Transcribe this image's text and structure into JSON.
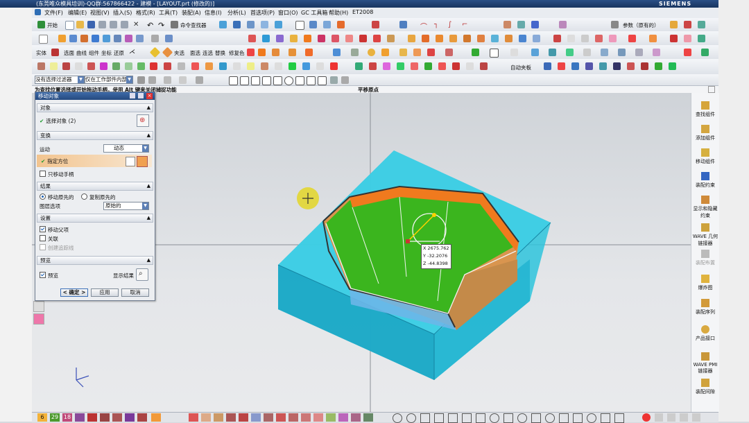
{
  "window": {
    "title": "(东莞唯众模具培训)-QQ群:567866422 - 建模 - [LAYOUT.prt (修改的)]",
    "brand": "SIEMENS"
  },
  "menubar": [
    "文件(F)",
    "编辑(E)",
    "视图(V)",
    "插入(S)",
    "格式(R)",
    "工具(T)",
    "装配(A)",
    "信息(I)",
    "分析(L)",
    "首选项(P)",
    "窗口(O)",
    "GC 工具箱",
    "帮助(H)",
    "ET2008"
  ],
  "toolbar1": {
    "start_label": "开始",
    "command_finder_label": "命令查找器",
    "reference_set_label": "参数（原有的）"
  },
  "toolbar3_labels": [
    "实体",
    "选面",
    "曲线",
    "组件",
    "坐标",
    "还原",
    "夹选",
    "面选",
    "连选",
    "替换",
    "修复色"
  ],
  "toolbar5": {
    "filter": "没有选择过滤器",
    "scope": "仅在工作部件内部",
    "assembly_label": "自动夹板"
  },
  "status": {
    "prompt": "为查找位置选择或开始拖动手柄，使用 Alt 键来关闭捕捉功能",
    "view_name": "平移原点"
  },
  "dialog": {
    "title": "移动对象",
    "sections": {
      "objects": "对象",
      "transform": "变换",
      "result": "结果",
      "settings": "设置",
      "preview": "预览"
    },
    "select_object_label": "选择对象 (2)",
    "motion_label": "运动",
    "motion_value": "动态",
    "specify_orientation_label": "指定方位",
    "move_handle_only_label": "只移动手柄",
    "move_original_label": "移动原先的",
    "copy_original_label": "复制原先的",
    "layer_option_label": "图层选项",
    "layer_option_value": "原始的",
    "move_parents_label": "移动父项",
    "associative_label": "关联",
    "create_trace_lines_label": "创建追踪线",
    "preview_label": "预览",
    "show_result_label": "显示结果",
    "ok_label": "< 确定 >",
    "apply_label": "应用",
    "cancel_label": "取消",
    "move_original_checked": true,
    "move_parents_checked": true,
    "preview_checked": true
  },
  "coordinates": {
    "x_label": "X",
    "x": "2675.762",
    "y_label": "Y",
    "y": "-32.2076",
    "z_label": "Z",
    "z": "-44.8398"
  },
  "resource_bar": [
    "查找组件",
    "添加组件",
    "移动组件",
    "装配约束",
    "显示和隐藏约束",
    "WAVE 几何链接器",
    "装配布置",
    "爆炸图",
    "装配序列",
    "产品接口",
    "WAVE PMI 链接器",
    "装配间隙"
  ],
  "taskbar_numbers": [
    "6",
    "29",
    "18"
  ],
  "colors": {
    "block": "#2ec4dc",
    "fill_green": "#3bb51e",
    "orange": "#f07a1e",
    "tan": "#d9954f",
    "title_blue": "#25497f"
  }
}
